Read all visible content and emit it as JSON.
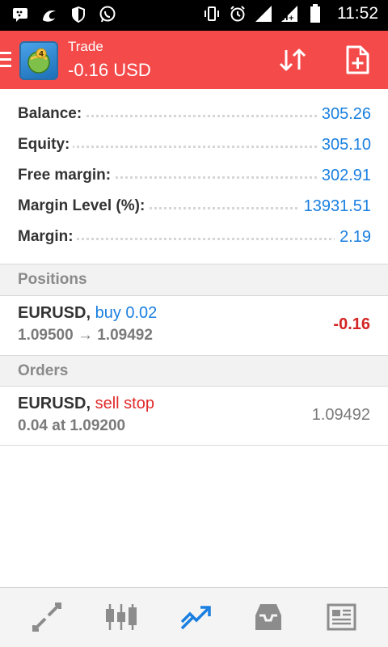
{
  "status_bar": {
    "time": "11:52",
    "left_icons": [
      "bbm-icon",
      "uc-browser-icon",
      "shield-icon",
      "whatsapp-icon"
    ],
    "right_icons": [
      "vibrate-icon",
      "alarm-icon",
      "signal-icon",
      "signal-h-plus-icon",
      "battery-icon"
    ]
  },
  "header": {
    "title": "Trade",
    "subtitle": "-0.16 USD",
    "background": "#f44a4a"
  },
  "summary": [
    {
      "label": "Balance:",
      "value": "305.26"
    },
    {
      "label": "Equity:",
      "value": "305.10"
    },
    {
      "label": "Free margin:",
      "value": "302.91"
    },
    {
      "label": "Margin Level (%):",
      "value": "13931.51"
    },
    {
      "label": "Margin:",
      "value": "2.19"
    }
  ],
  "positions": {
    "title": "Positions",
    "items": [
      {
        "symbol": "EURUSD,",
        "side": "buy 0.02",
        "detail": "1.09500 → 1.09492",
        "profit": "-0.16"
      }
    ]
  },
  "orders": {
    "title": "Orders",
    "items": [
      {
        "symbol": "EURUSD,",
        "side": "sell stop",
        "detail": "0.04 at 1.09200",
        "price": "1.09492"
      }
    ]
  },
  "bottom_nav": [
    "quotes-icon",
    "chart-icon",
    "trade-icon",
    "history-icon",
    "news-icon"
  ],
  "colors": {
    "accent_blue": "#1a7fe0",
    "negative_red": "#d42424",
    "header_red": "#f44a4a"
  }
}
